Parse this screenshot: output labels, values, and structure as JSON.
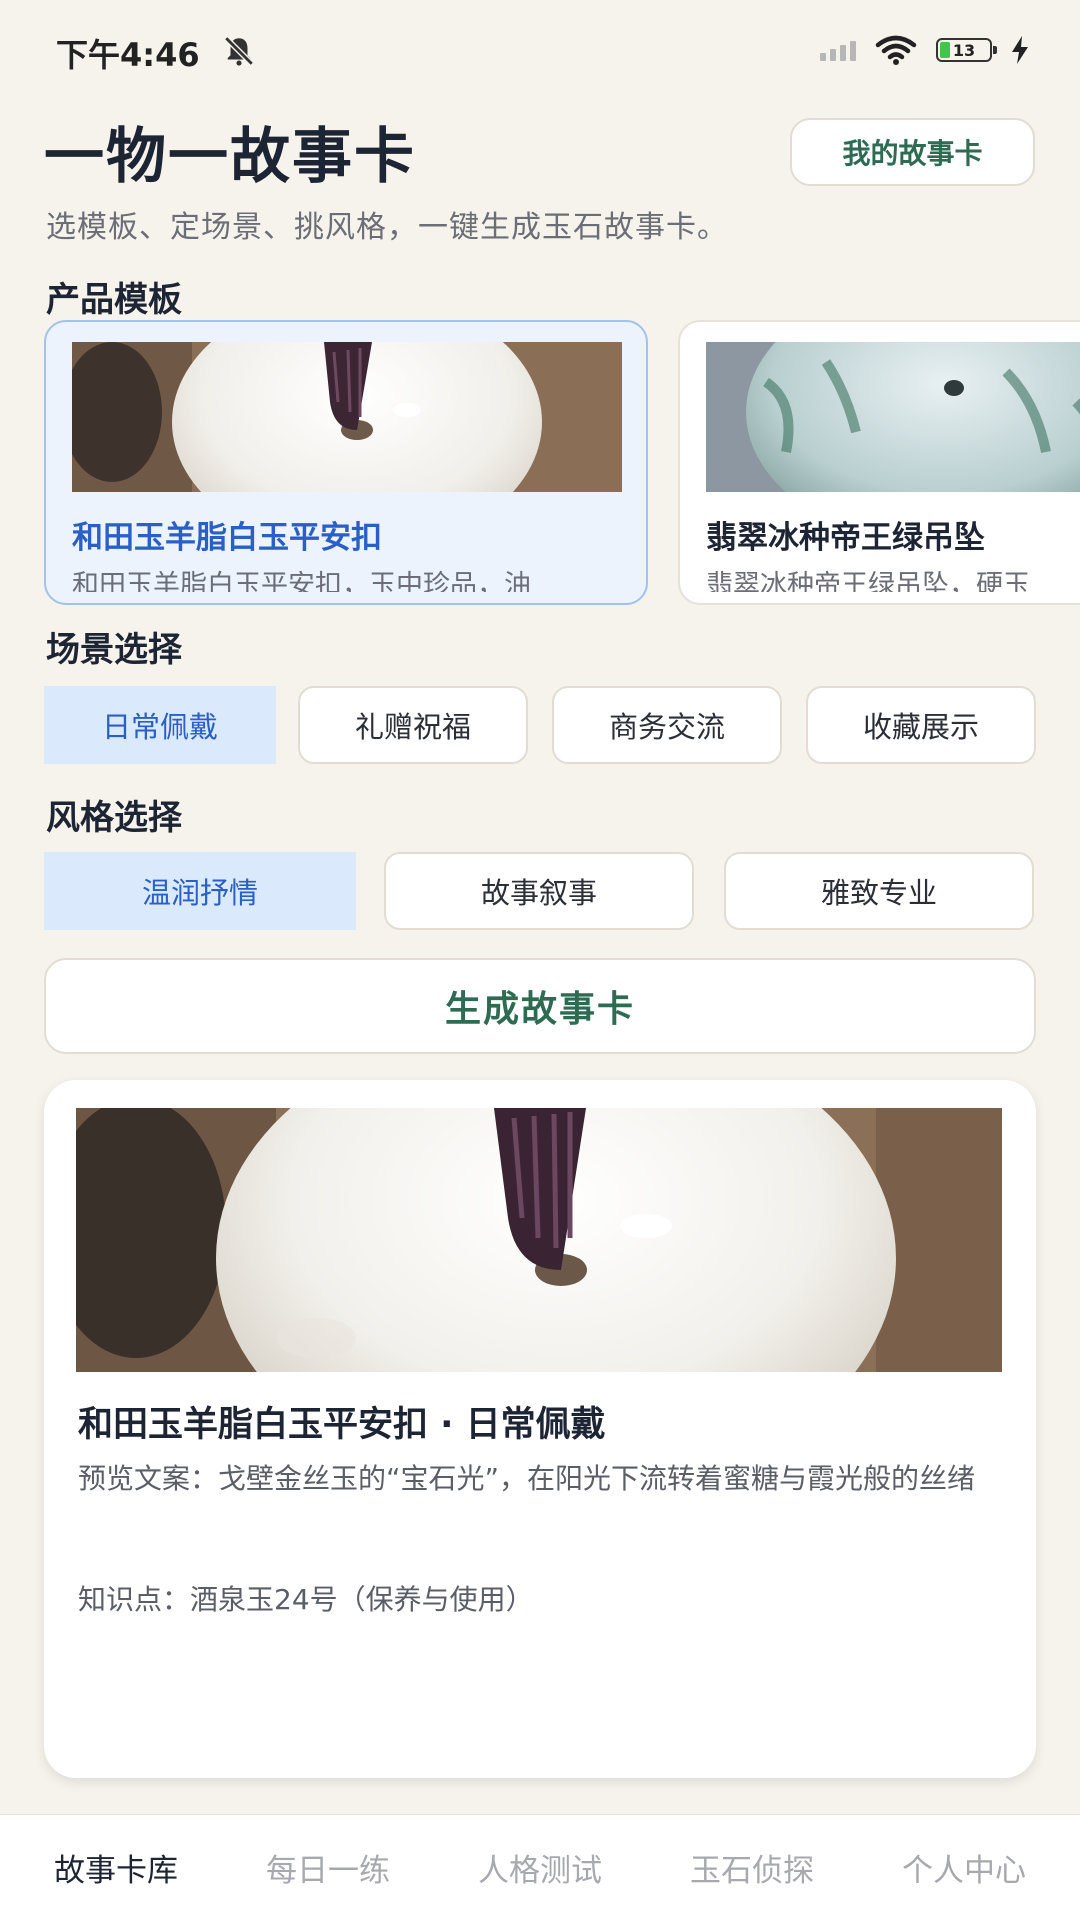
{
  "status_bar": {
    "time": "下午4:46",
    "battery": "13",
    "icons": [
      "notification-muted-icon",
      "signal-icon",
      "wifi-icon",
      "battery-icon",
      "charging-icon"
    ]
  },
  "header": {
    "title": "一物一故事卡",
    "my_cards_button": "我的故事卡",
    "subtitle": "选模板、定场景、挑风格，一键生成玉石故事卡。"
  },
  "templates": {
    "label": "产品模板",
    "items": [
      {
        "title": "和田玉羊脂白玉平安扣",
        "desc": "和田玉羊脂白玉平安扣，玉中珍品，油",
        "selected": true
      },
      {
        "title": "翡翠冰种帝王绿吊坠",
        "desc": "翡翠冰种帝王绿吊坠，硬玉",
        "selected": false
      }
    ]
  },
  "scenes": {
    "label": "场景选择",
    "items": [
      {
        "label": "日常佩戴",
        "selected": true
      },
      {
        "label": "礼赠祝福",
        "selected": false
      },
      {
        "label": "商务交流",
        "selected": false
      },
      {
        "label": "收藏展示",
        "selected": false
      }
    ]
  },
  "styles": {
    "label": "风格选择",
    "items": [
      {
        "label": "温润抒情",
        "selected": true
      },
      {
        "label": "故事叙事",
        "selected": false
      },
      {
        "label": "雅致专业",
        "selected": false
      }
    ]
  },
  "generate_button": "生成故事卡",
  "preview": {
    "title": "和田玉羊脂白玉平安扣 · 日常佩戴",
    "text": "预览文案：戈壁金丝玉的“宝石光”，在阳光下流转着蜜糖与霞光般的丝绪",
    "knowledge": "知识点：酒泉玉24号（保养与使用）"
  },
  "bottom_nav": {
    "items": [
      {
        "label": "故事卡库",
        "active": true
      },
      {
        "label": "每日一练",
        "active": false
      },
      {
        "label": "人格测试",
        "active": false
      },
      {
        "label": "玉石侦探",
        "active": false
      },
      {
        "label": "个人中心",
        "active": false
      }
    ]
  },
  "colors": {
    "background": "#f6f3ec",
    "accent_green": "#2e6b53",
    "accent_blue": "#2a5fc7",
    "selected_chip": "#dbe9fc"
  }
}
